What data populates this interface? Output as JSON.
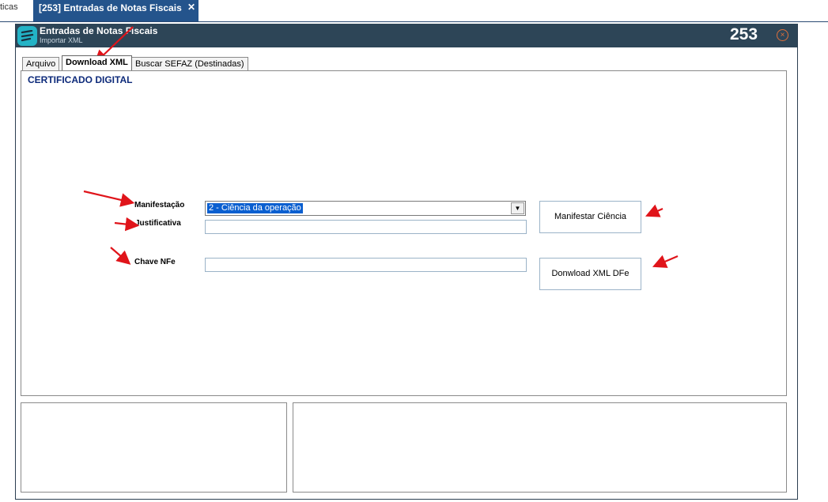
{
  "tabstrip": {
    "prev_tab_label": "ticas",
    "active_tab_label": "[253] Entradas de Notas Fiscais",
    "close_glyph": "✕"
  },
  "window": {
    "title": "Entradas de Notas Fiscais",
    "subtitle": "Importar XML",
    "number": "253",
    "close_glyph": "×",
    "accent_color": "#24548c",
    "titlebar_color": "#2d4557"
  },
  "tabs": [
    {
      "label": "Arquivo"
    },
    {
      "label": "Download XML"
    },
    {
      "label": "Buscar SEFAZ (Destinadas)"
    }
  ],
  "panel": {
    "title": "CERTIFICADO DIGITAL",
    "manifestacao_label": "Manifestação",
    "manifestacao_value": "2 - Ciência da operação",
    "justificativa_label": "Justificativa",
    "justificativa_value": "",
    "chave_label": "Chave NFe",
    "chave_value": "",
    "manifestar_button": "Manifestar Ciência",
    "download_button": "Donwload XML DFe"
  },
  "annotation_color": "#e0141a"
}
